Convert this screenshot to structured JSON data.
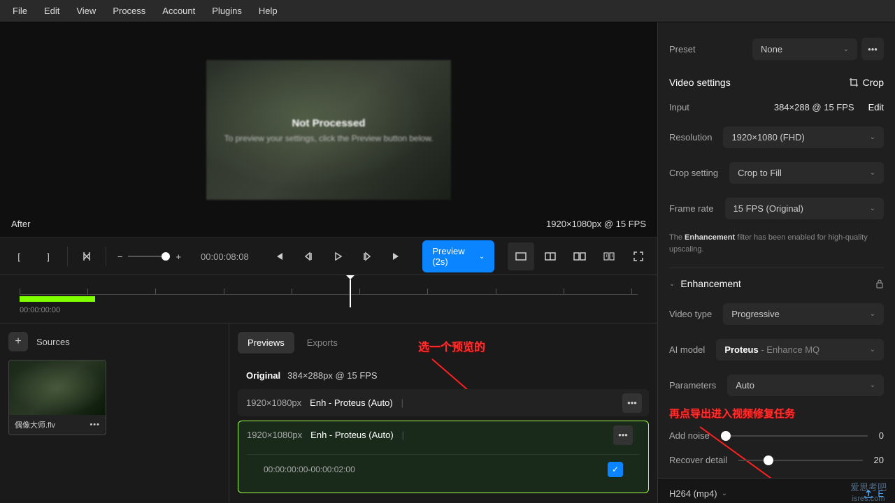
{
  "menu": [
    "File",
    "Edit",
    "View",
    "Process",
    "Account",
    "Plugins",
    "Help"
  ],
  "preview": {
    "title": "Not Processed",
    "subtitle": "To preview your settings, click the Preview button below.",
    "after": "After",
    "resolution": "1920×1080px @ 15 FPS"
  },
  "toolbar": {
    "timecode": "00:00:08:08",
    "preview_btn": "Preview (2s)"
  },
  "timeline": {
    "start": "00:00:00:00"
  },
  "sources": {
    "header": "Sources",
    "file": "偶像大师.flv"
  },
  "tabs": {
    "previews": "Previews",
    "exports": "Exports"
  },
  "original": {
    "label": "Original",
    "info": "384×288px @ 15 FPS"
  },
  "rows": [
    {
      "res": "1920×1080px",
      "name": "Enh - Proteus (Auto)"
    },
    {
      "res": "1920×1080px",
      "name": "Enh - Proteus (Auto)",
      "range": "00:00:00:00-00:00:02:00"
    }
  ],
  "annotations": {
    "a1": "选一个预览的",
    "a2": "再点导出进入视频修复任务"
  },
  "panel": {
    "preset_label": "Preset",
    "preset_val": "None",
    "video_settings": "Video settings",
    "crop": "Crop",
    "input_label": "Input",
    "input_val": "384×288 @ 15 FPS",
    "edit": "Edit",
    "resolution_label": "Resolution",
    "resolution_val": "1920×1080 (FHD)",
    "crop_setting_label": "Crop setting",
    "crop_setting_val": "Crop to Fill",
    "frame_rate_label": "Frame rate",
    "frame_rate_val": "15 FPS (Original)",
    "note_pre": "The ",
    "note_b": "Enhancement",
    "note_post": " filter has been enabled for high-quality upscaling.",
    "enhancement": "Enhancement",
    "video_type_label": "Video type",
    "video_type_val": "Progressive",
    "ai_model_label": "AI model",
    "ai_model_val": "Proteus",
    "ai_model_suffix": " - Enhance MQ",
    "parameters_label": "Parameters",
    "parameters_val": "Auto",
    "add_noise_label": "Add noise",
    "add_noise_val": "0",
    "recover_detail_label": "Recover detail",
    "recover_detail_val": "20",
    "export_format": "H264 (mp4)",
    "export_label": "E"
  },
  "watermark": {
    "top": "爱思考吧",
    "bottom": "isres.com"
  }
}
